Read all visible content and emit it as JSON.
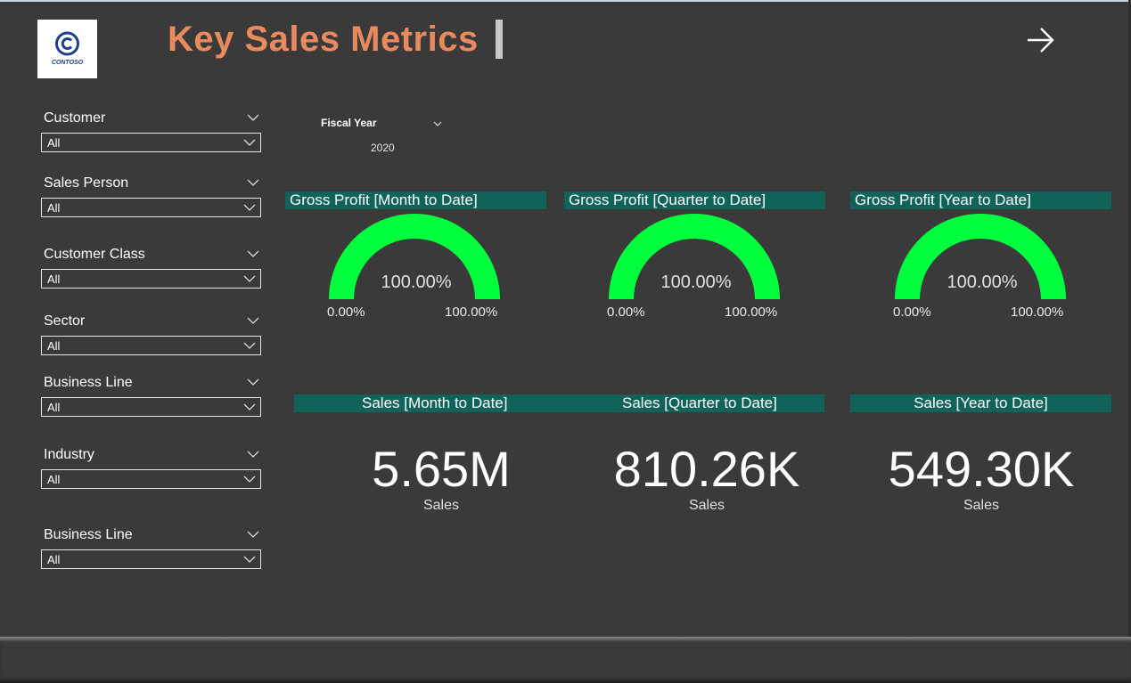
{
  "header": {
    "logo_text": "CONTOSO",
    "title": "Key Sales Metrics"
  },
  "colors": {
    "background": "#3a3a3a",
    "title": "#e98a5e",
    "band": "#11635a",
    "gauge_fill": "#00ff3c"
  },
  "slicers": [
    {
      "label": "Customer",
      "value": "All"
    },
    {
      "label": "Sales Person",
      "value": "All"
    },
    {
      "label": "Customer Class",
      "value": "All"
    },
    {
      "label": "Sector",
      "value": "All"
    },
    {
      "label": "Business Line",
      "value": "All"
    },
    {
      "label": "Industry",
      "value": "All"
    },
    {
      "label": "Business Line",
      "value": "All"
    }
  ],
  "fiscal_year": {
    "label": "Fiscal Year",
    "value": "2020"
  },
  "gauges": [
    {
      "title": "Gross Profit [Month to Date]",
      "value": "100.00%",
      "min": "0.00%",
      "max": "100.00%",
      "fill_fraction": 1.0
    },
    {
      "title": "Gross Profit [Quarter to Date]",
      "value": "100.00%",
      "min": "0.00%",
      "max": "100.00%",
      "fill_fraction": 1.0
    },
    {
      "title": "Gross Profit [Year to Date]",
      "value": "100.00%",
      "min": "0.00%",
      "max": "100.00%",
      "fill_fraction": 1.0
    }
  ],
  "cards": [
    {
      "title": "Sales [Month to Date]",
      "value": "5.65M",
      "label": "Sales"
    },
    {
      "title": "Sales [Quarter to Date]",
      "value": "810.26K",
      "label": "Sales"
    },
    {
      "title": "Sales [Year to Date]",
      "value": "549.30K",
      "label": "Sales"
    }
  ]
}
